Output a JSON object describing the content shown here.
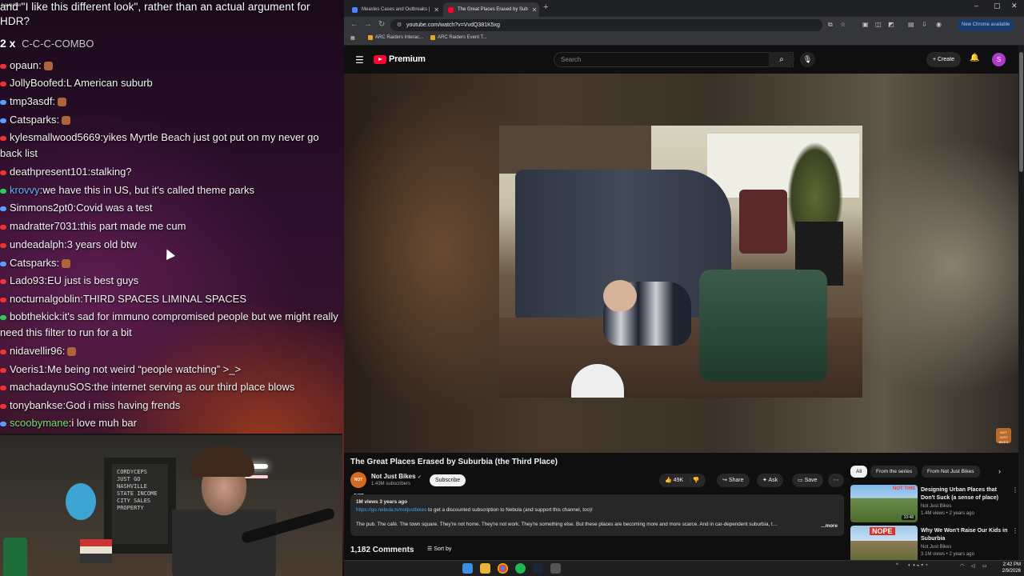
{
  "stream": {
    "launcher_label": "Launcher",
    "top_message": "and \"I like this different look\", rather than an actual argument for HDR?",
    "combo": {
      "count": "2 x",
      "text": "C-C-C-COMBO"
    },
    "chat": [
      {
        "user": "opaun",
        "text": "",
        "style": ""
      },
      {
        "user": "JollyBoofed",
        "text": "L American suburb",
        "style": ""
      },
      {
        "user": "tmp3asdf",
        "text": "",
        "style": ""
      },
      {
        "user": "Catsparks",
        "text": "",
        "style": ""
      },
      {
        "user": "kylesmallwood5669",
        "text": "yikes Myrtle Beach just got put on my never go back list",
        "style": ""
      },
      {
        "user": "deathpresent101",
        "text": "stalking?",
        "style": ""
      },
      {
        "user": "krovvy",
        "text": "we have this in US, but it's called theme parks",
        "style": "blue"
      },
      {
        "user": "Simmons2pt0",
        "text": "Covid was a test",
        "style": ""
      },
      {
        "user": "madratter7031",
        "text": "this part made me cum",
        "style": ""
      },
      {
        "user": "undeadalph",
        "text": "3 years old btw",
        "style": ""
      },
      {
        "user": "Catsparks",
        "text": "",
        "style": ""
      },
      {
        "user": "Lado93",
        "text": "EU just is best guys",
        "style": ""
      },
      {
        "user": "nocturnalgoblin",
        "text": "THIRD SPACES LIMINAL SPACES",
        "style": ""
      },
      {
        "user": "bobthekick",
        "text": "it's sad for immuno compromised people but we might really need this filter to run for a bit",
        "style": ""
      },
      {
        "user": "nidavellir96",
        "text": "",
        "style": ""
      },
      {
        "user": "Voeris1",
        "text": "Me being not weird “people watching” >_>",
        "style": ""
      },
      {
        "user": "machadaynuSOS",
        "text": "the internet serving as our third place blows",
        "style": ""
      },
      {
        "user": "tonybankse",
        "text": "God i miss having frends",
        "style": ""
      },
      {
        "user": "scoobymane",
        "text": "i love muh bar",
        "style": "green"
      }
    ],
    "webcam_board": "CORDYCEPS\nJUST GO\nNASHVILLE\nSTATE INCOME\nCITY SALES\nPROPERTY"
  },
  "browser": {
    "tabs": [
      {
        "label": "Measles Cases and Outbreaks |",
        "active": false,
        "color": "#4f84ff"
      },
      {
        "label": "The Great Places Erased by Sub",
        "active": true,
        "color": "#ff0033"
      }
    ],
    "url": "youtube.com/watch?v=VvdQ381K5xg",
    "chrome_available": "New Chrome available",
    "bookmarks": [
      "ARC Raiders Interac...",
      "ARC Raiders Event T..."
    ],
    "youtube": {
      "brand": "Premium",
      "search_placeholder": "Search",
      "create_label": "+ Create",
      "avatar_letter": "S",
      "watermark": "NOT JUST BIKES",
      "title": "The Great Places Erased by Suburbia (the Third Place)",
      "channel": "Not Just Bikes",
      "channel_avatar_text": "NOT JUST",
      "subscribers": "1.43M subscribers",
      "subscribe_label": "Subscribe",
      "likes": "49K",
      "share_label": "Share",
      "ask_label": "Ask",
      "save_label": "Save",
      "description": {
        "meta": "1M views  3 years ago",
        "link": "https://go.nebula.tv/notjustbikes",
        "line1_rest": " to get a discounted subscription to Nebula (and support this channel, too)!",
        "line2": "The pub. The café. The town square. They're not home. They're not work. They're something else. But these places are becoming more and more scarce. And in car-dependent suburbia, t…",
        "more": "...more"
      },
      "comments_count": "1,182 Comments",
      "sort_label": "Sort by",
      "chips": [
        "All",
        "From the series",
        "From Not Just Bikes"
      ],
      "recommendations": [
        {
          "title": "Designing Urban Places that Don't Suck (a sense of place)",
          "channel": "Not Just Bikes",
          "meta": "1.4M views • 2 years ago",
          "duration": "10:48",
          "thumb_text": "NOT THIS"
        },
        {
          "title": "Why We Won't Raise Our Kids in Suburbia",
          "channel": "Not Just Bikes",
          "meta": "3.1M views • 2 years ago",
          "duration": "",
          "thumb_text": "NOPE"
        }
      ]
    }
  },
  "taskbar": {
    "time": "2:42 PM",
    "date": "2/9/2026"
  }
}
